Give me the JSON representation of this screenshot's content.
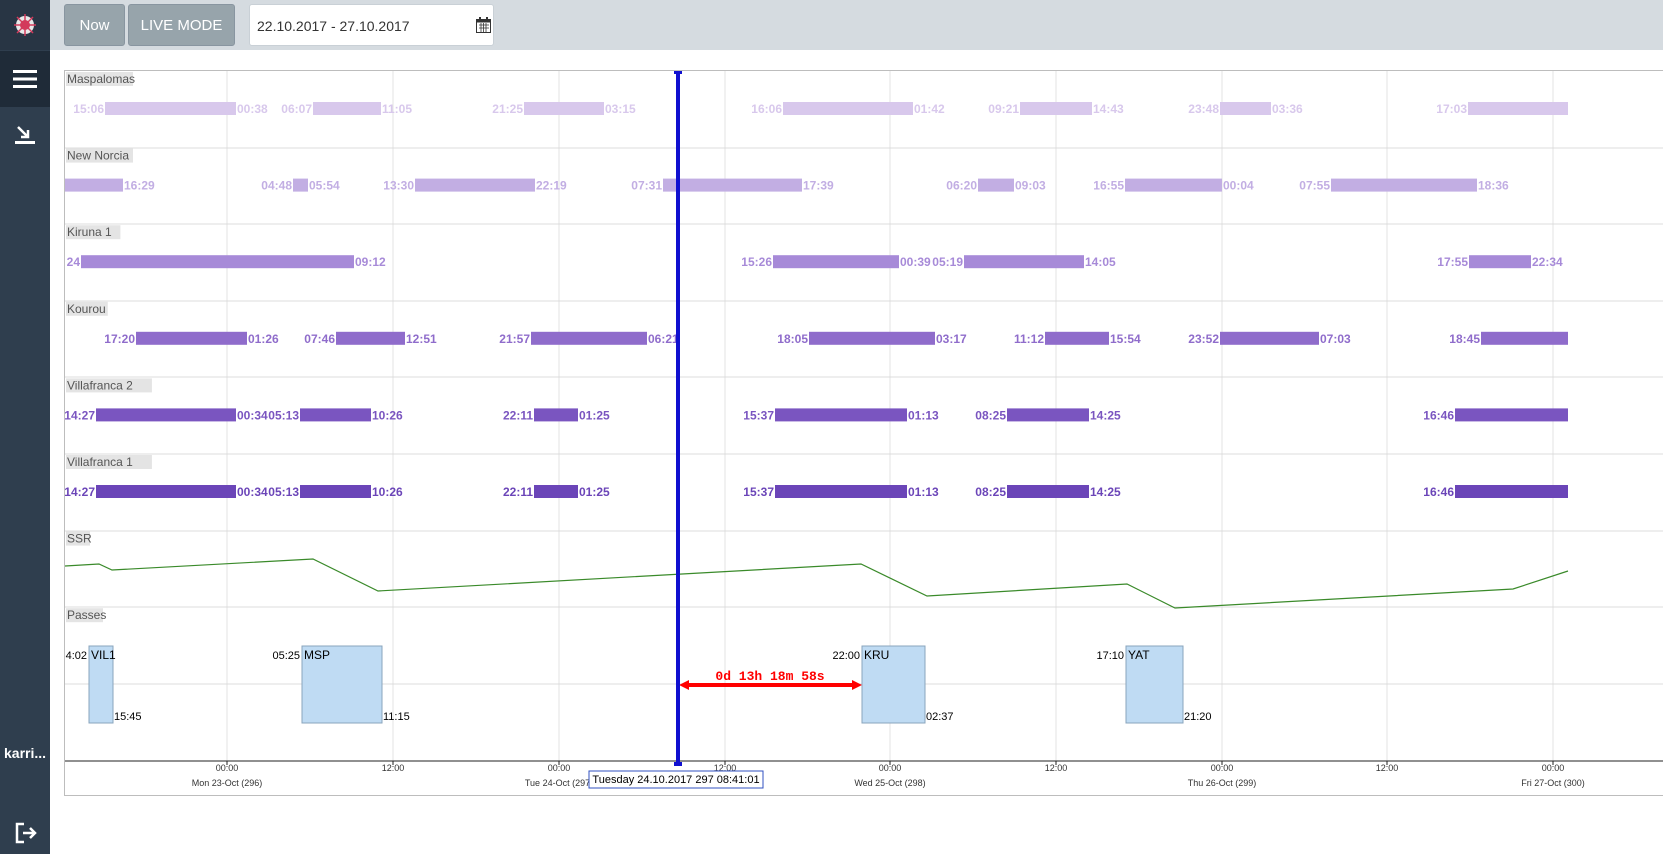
{
  "sidebar": {
    "logo_icon": "app-logo-icon",
    "menu_icon": "list-icon",
    "download_icon": "download-icon",
    "user": "karri...",
    "logout_icon": "logout-icon"
  },
  "toolbar": {
    "now_label": "Now",
    "live_mode_label": "LIVE MODE",
    "date_range": "22.10.2017 - 27.10.2017",
    "calendar_icon": "calendar-icon",
    "edit_icon": "pencil-icon"
  },
  "colors": {
    "sidebar": "#2f3e4e",
    "topbar": "#d5dbe0",
    "now_line": "#1010d0",
    "duration_arrow": "#ff0000",
    "ssr_line": "#3a8a2a",
    "passes_fill": "#bfdbf3",
    "station_shades": [
      "#d8c8ec",
      "#c2aee3",
      "#a78ad8",
      "#8f6ccb",
      "#7a55c0",
      "#6b45b8"
    ]
  },
  "timeline": {
    "current_time_label": "Tuesday 24.10.2017 297 08:41:01",
    "duration_label": "0d 13h 18m 58s",
    "axis_ticks": [
      {
        "time": "00:00",
        "date": "Mon 23-Oct (296)"
      },
      {
        "time": "12:00",
        "date": ""
      },
      {
        "time": "00:00",
        "date": "Tue 24-Oct (297)"
      },
      {
        "time": "12:00",
        "date": ""
      },
      {
        "time": "00:00",
        "date": "Wed 25-Oct (298)"
      },
      {
        "time": "12:00",
        "date": ""
      },
      {
        "time": "00:00",
        "date": "Thu 26-Oct (299)"
      },
      {
        "time": "12:00",
        "date": ""
      },
      {
        "time": "00:00",
        "date": "Fri 27-Oct (300)"
      }
    ],
    "stations": [
      {
        "name": "Maspalomas",
        "shade": 0,
        "passes": [
          {
            "start": "15:06",
            "end": "00:38"
          },
          {
            "start": "06:07",
            "end": "11:05"
          },
          {
            "start": "21:25",
            "end": "03:15"
          },
          {
            "start": "16:06",
            "end": "01:42"
          },
          {
            "start": "09:21",
            "end": "14:43"
          },
          {
            "start": "23:48",
            "end": "03:36"
          },
          {
            "start": "17:03",
            "end": ""
          }
        ]
      },
      {
        "name": "New Norcia",
        "shade": 1,
        "passes": [
          {
            "start": "",
            "end": "16:29"
          },
          {
            "start": "04:48",
            "end": "05:54"
          },
          {
            "start": "13:30",
            "end": "22:19"
          },
          {
            "start": "07:31",
            "end": "17:39"
          },
          {
            "start": "06:20",
            "end": "09:03"
          },
          {
            "start": "16:55",
            "end": "00:04"
          },
          {
            "start": "07:55",
            "end": "18:36"
          }
        ]
      },
      {
        "name": "Kiruna 1",
        "shade": 2,
        "passes": [
          {
            "start": "24",
            "end": "09:12"
          },
          {
            "start": "15:26",
            "end": "00:39"
          },
          {
            "start": "05:19",
            "end": "14:05"
          },
          {
            "start": "17:55",
            "end": "22:34"
          }
        ]
      },
      {
        "name": "Kourou",
        "shade": 3,
        "passes": [
          {
            "start": "17:20",
            "end": "01:26"
          },
          {
            "start": "07:46",
            "end": "12:51"
          },
          {
            "start": "21:57",
            "end": "06:21"
          },
          {
            "start": "18:05",
            "end": "03:17"
          },
          {
            "start": "11:12",
            "end": "15:54"
          },
          {
            "start": "23:52",
            "end": "07:03"
          },
          {
            "start": "18:45",
            "end": ""
          }
        ]
      },
      {
        "name": "Villafranca 2",
        "shade": 4,
        "passes": [
          {
            "start": "14:27",
            "end": "00:34"
          },
          {
            "start": "05:13",
            "end": "10:26"
          },
          {
            "start": "22:11",
            "end": "01:25"
          },
          {
            "start": "15:37",
            "end": "01:13"
          },
          {
            "start": "08:25",
            "end": "14:25"
          },
          {
            "start": "16:46",
            "end": ""
          }
        ]
      },
      {
        "name": "Villafranca 1",
        "shade": 5,
        "passes": [
          {
            "start": "14:27",
            "end": "00:34"
          },
          {
            "start": "05:13",
            "end": "10:26"
          },
          {
            "start": "22:11",
            "end": "01:25"
          },
          {
            "start": "15:37",
            "end": "01:13"
          },
          {
            "start": "08:25",
            "end": "14:25"
          },
          {
            "start": "16:46",
            "end": ""
          }
        ]
      }
    ],
    "ssr": {
      "name": "SSR"
    },
    "passes_row": {
      "name": "Passes",
      "items": [
        {
          "label": "VIL1",
          "start": "4:02",
          "end": "15:45"
        },
        {
          "label": "MSP",
          "start": "05:25",
          "end": "11:15"
        },
        {
          "label": "KRU",
          "start": "22:00",
          "end": "02:37"
        },
        {
          "label": "YAT",
          "start": "17:10",
          "end": "21:20"
        }
      ]
    }
  }
}
